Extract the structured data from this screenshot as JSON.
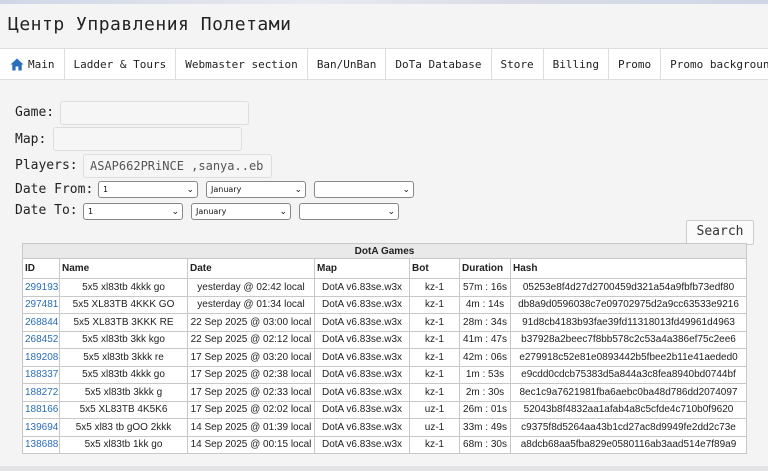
{
  "title": "Центр Управления Полетами",
  "nav": {
    "items": [
      "Main",
      "Ladder & Tours",
      "Webmaster section",
      "Ban/UnBan",
      "DoTa Database",
      "Store",
      "Billing",
      "Promo",
      "Promo background"
    ]
  },
  "form": {
    "game_label": "Game:",
    "game_value": "",
    "map_label": "Map:",
    "map_value": "",
    "players_label": "Players:",
    "players_value": "ASAP662PRiNCE ,sanya..eb",
    "date_from_label": "Date From:",
    "date_to_label": "Date To:",
    "from_day": "1",
    "from_month": "January",
    "from_year": "",
    "to_day": "1",
    "to_month": "January",
    "to_year": "",
    "search_label": "Search"
  },
  "table": {
    "caption": "DotA Games",
    "columns": [
      "ID",
      "Name",
      "Date",
      "Map",
      "Bot",
      "Duration",
      "Hash"
    ],
    "rows": [
      [
        "299193",
        "5x5 xl83tb 4kkk go",
        "yesterday @ 02:42 local",
        "DotA v6.83se.w3x",
        "kz-1",
        "57m : 16s",
        "05253e8f4d27d2700459d321a54a9fbfb73edf80"
      ],
      [
        "297481",
        "5x5 XL83TB 4KKK GO",
        "yesterday @ 01:34 local",
        "DotA v6.83se.w3x",
        "kz-1",
        "4m : 14s",
        "db8a9d0596038c7e09702975d2a9cc63533e9216"
      ],
      [
        "268844",
        "5x5 XL83TB 3KKK RE",
        "22 Sep 2025 @ 03:00 local",
        "DotA v6.83se.w3x",
        "kz-1",
        "28m : 34s",
        "91d8cb4183b93fae39fd11318013fd49961d4963"
      ],
      [
        "268452",
        "5x5 xl83tb 3kk kgo",
        "22 Sep 2025 @ 02:12 local",
        "DotA v6.83se.w3x",
        "kz-1",
        "41m : 47s",
        "b37928a2beec7f8bb578c2c53a4a386ef75c2ee6"
      ],
      [
        "189208",
        "5x5 xl83tb 3kkk re",
        "17 Sep 2025 @ 03:20 local",
        "DotA v6.83se.w3x",
        "kz-1",
        "42m : 06s",
        "e279918c52e81e0893442b5fbee2b11e41aeded0"
      ],
      [
        "188337",
        "5x5 xl83tb 4kkk go",
        "17 Sep 2025 @ 02:38 local",
        "DotA v6.83se.w3x",
        "kz-1",
        "1m : 53s",
        "e9cdd0cdcb75383d5a844a3c8fea8940bd0744bf"
      ],
      [
        "188272",
        "5x5 xl83tb 3kkk g",
        "17 Sep 2025 @ 02:33 local",
        "DotA v6.83se.w3x",
        "kz-1",
        "2m : 30s",
        "8ec1c9a7621981fba6aebc0ba48d786dd2074097"
      ],
      [
        "188166",
        "5x5 XL83TB 4K5K6",
        "17 Sep 2025 @ 02:02 local",
        "DotA v6.83se.w3x",
        "uz-1",
        "26m : 01s",
        "52043b8f4832aa1afab4a8c5cfde4c710b0f9620"
      ],
      [
        "139694",
        "5x5 xl83 tb gOO 2kkk",
        "14 Sep 2025 @ 01:39 local",
        "DotA v6.83se.w3x",
        "uz-1",
        "33m : 49s",
        "c9375f8d5264aa43b1cd27ac8d9949fe2dd2c73e"
      ],
      [
        "138688",
        "5x5 xl83tb 1kk go",
        "14 Sep 2025 @ 00:15 local",
        "DotA v6.83se.w3x",
        "kz-1",
        "68m : 30s",
        "a8dcb68aa5fba829e0580116ab3aad514e7f89a9"
      ]
    ]
  },
  "icons": {
    "home": "home-icon"
  },
  "colors": {
    "link": "#2a6db8",
    "home_icon": "#2a6db8"
  }
}
